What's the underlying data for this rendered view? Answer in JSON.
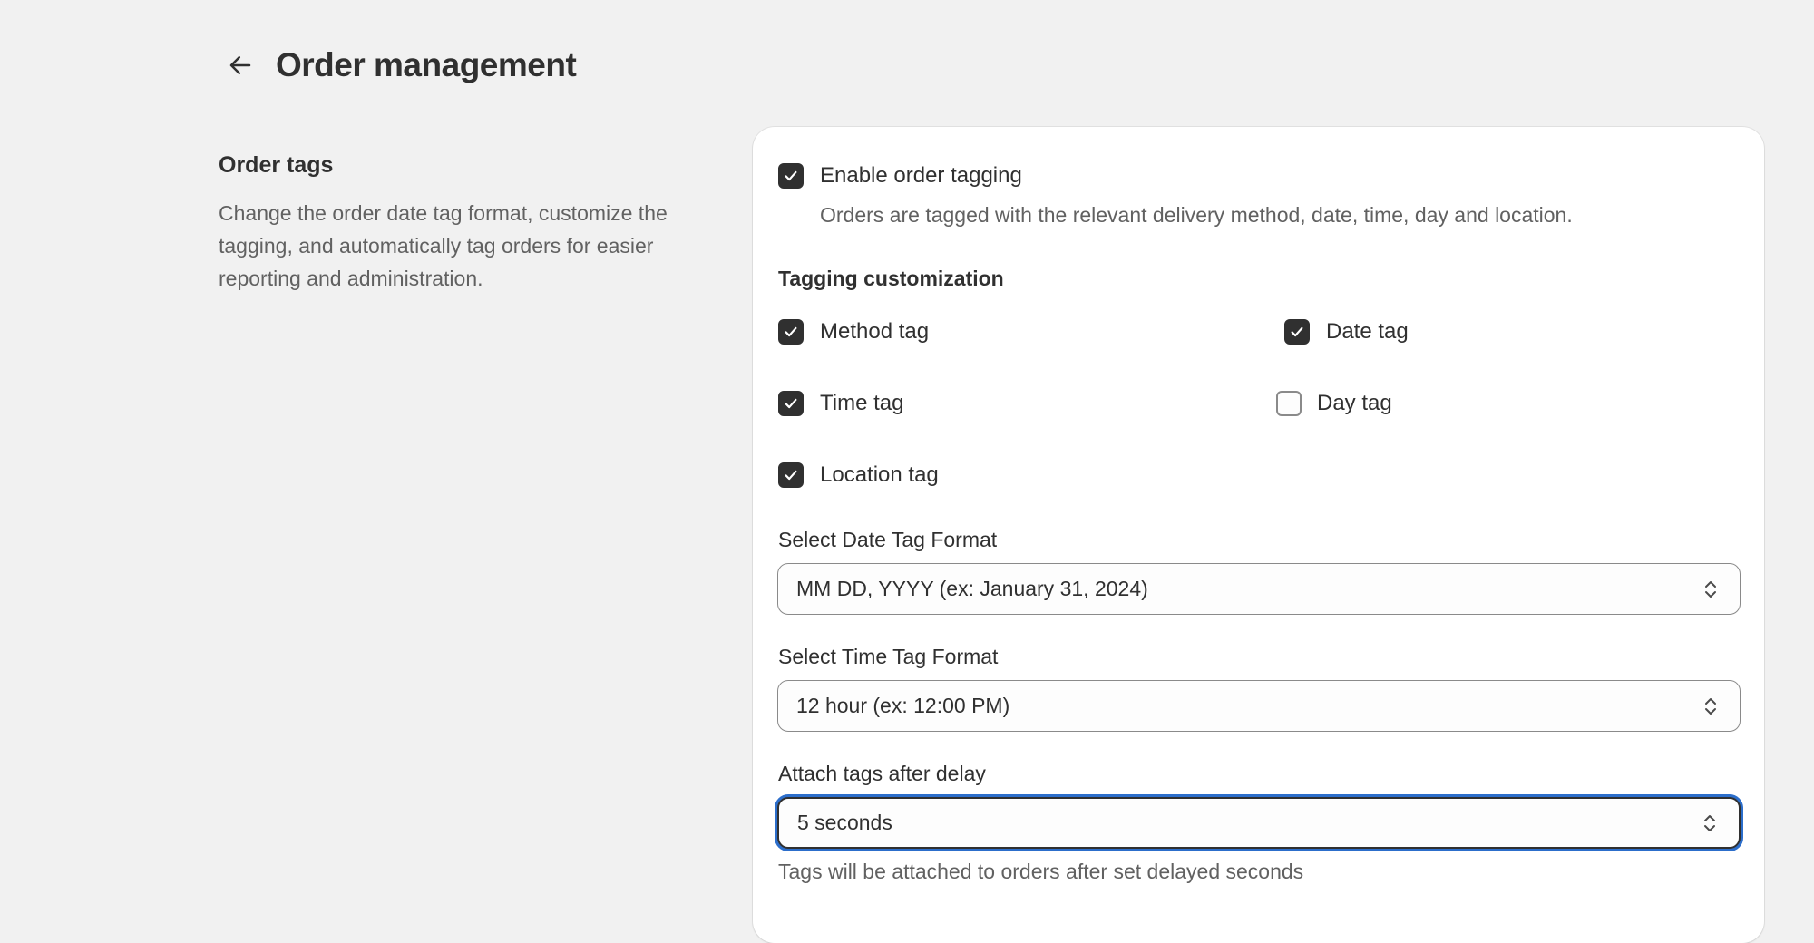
{
  "header": {
    "title": "Order management"
  },
  "aside": {
    "title": "Order tags",
    "description": "Change the order date tag format, customize the tagging, and automatically tag orders for easier reporting and administration."
  },
  "enable_tagging": {
    "label": "Enable order tagging",
    "help": "Orders are tagged with the relevant delivery method, date, time, day and location.",
    "checked": true
  },
  "customization": {
    "heading": "Tagging customization",
    "tags": [
      {
        "label": "Method tag",
        "checked": true
      },
      {
        "label": "Date tag",
        "checked": true
      },
      {
        "label": "Time tag",
        "checked": true
      },
      {
        "label": "Day tag",
        "checked": false
      },
      {
        "label": "Location tag",
        "checked": true
      }
    ]
  },
  "date_format": {
    "label": "Select Date Tag Format",
    "value": "MM DD, YYYY (ex: January 31, 2024)"
  },
  "time_format": {
    "label": "Select Time Tag Format",
    "value": "12 hour (ex: 12:00 PM)"
  },
  "delay": {
    "label": "Attach tags after delay",
    "value": "5 seconds",
    "help": "Tags will be attached to orders after set delayed seconds"
  },
  "colors": {
    "background": "#f1f1f1",
    "card": "#ffffff",
    "text": "#303030",
    "muted": "#616161",
    "focus_ring": "#2c6ecb"
  }
}
